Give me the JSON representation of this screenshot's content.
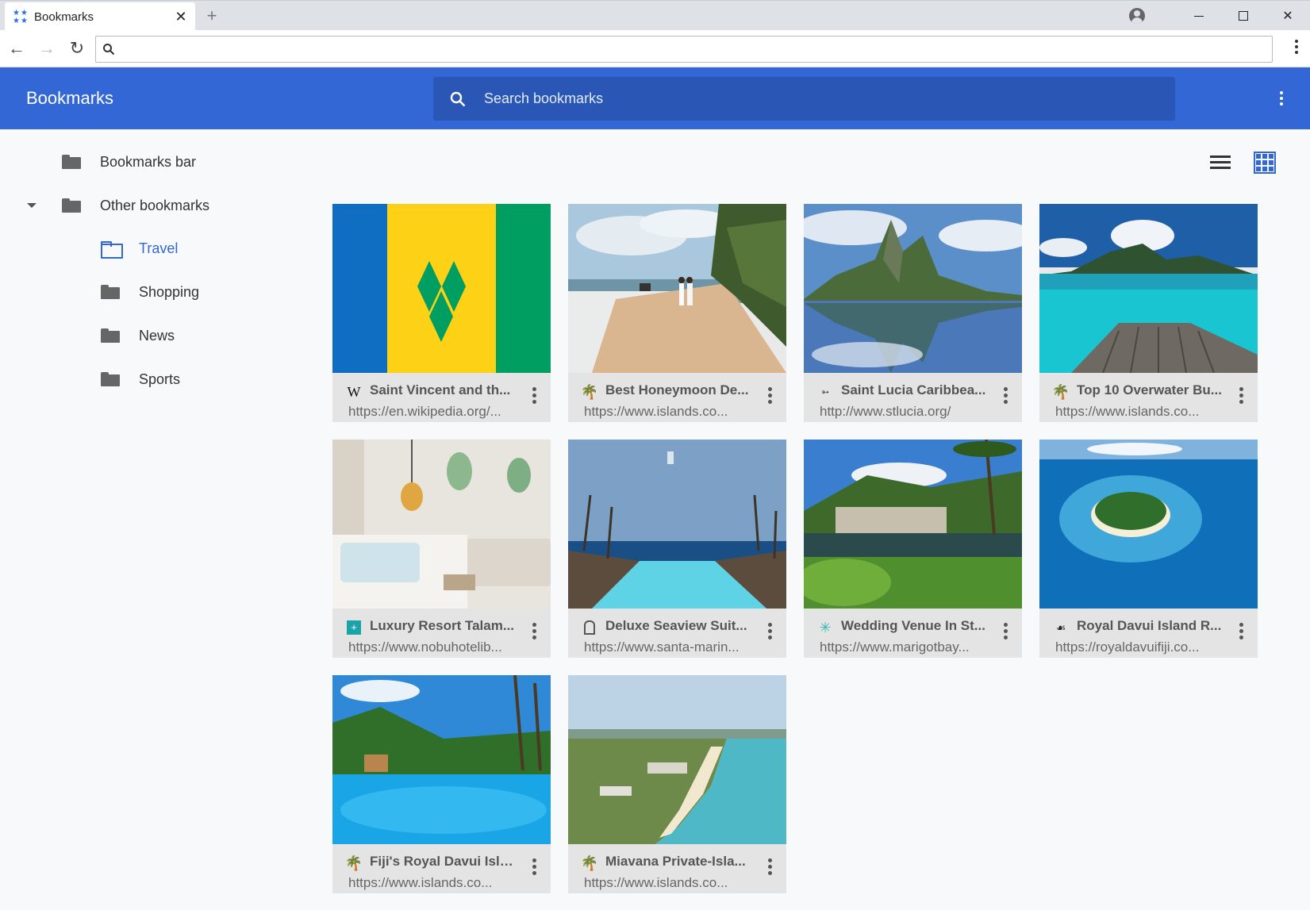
{
  "window": {
    "tab_title": "Bookmarks",
    "tab_close": "✕",
    "new_tab": "+"
  },
  "toolbar": {
    "back": "←",
    "forward": "→",
    "reload": "↻",
    "address_value": ""
  },
  "app": {
    "title": "Bookmarks",
    "search_placeholder": "Search bookmarks",
    "accent_color": "#3367d6"
  },
  "sidebar": {
    "items": [
      {
        "label": "Bookmarks bar",
        "icon": "folder-icon"
      },
      {
        "label": "Other bookmarks",
        "icon": "folder-icon",
        "expanded": true
      },
      {
        "label": "Travel",
        "icon": "folder-open-icon",
        "selected": true
      },
      {
        "label": "Shopping",
        "icon": "folder-icon"
      },
      {
        "label": "News",
        "icon": "folder-icon"
      },
      {
        "label": "Sports",
        "icon": "folder-icon"
      }
    ]
  },
  "view": {
    "mode": "grid"
  },
  "cards": [
    {
      "title": "Saint Vincent and th...",
      "url": "https://en.wikipedia.org/...",
      "favicon": "W"
    },
    {
      "title": "Best Honeymoon De...",
      "url": "https://www.islands.co...",
      "favicon": "palm"
    },
    {
      "title": "Saint Lucia Caribbea...",
      "url": "http://www.stlucia.org/",
      "favicon": "bird"
    },
    {
      "title": "Top 10 Overwater Bu...",
      "url": "https://www.islands.co...",
      "favicon": "palm"
    },
    {
      "title": "Luxury Resort Talam...",
      "url": "https://www.nobuhotelib...",
      "favicon": "nobu"
    },
    {
      "title": "Deluxe Seaview Suit...",
      "url": "https://www.santa-marin...",
      "favicon": "tower"
    },
    {
      "title": "Wedding Venue In St...",
      "url": "https://www.marigotbay...",
      "favicon": "star"
    },
    {
      "title": "Royal Davui Island R...",
      "url": "https://royaldavuifiji.co...",
      "favicon": "davui"
    },
    {
      "title": "Fiji's Royal Davui Isla...",
      "url": "https://www.islands.co...",
      "favicon": "palm"
    },
    {
      "title": "Miavana Private-Isla...",
      "url": "https://www.islands.co...",
      "favicon": "palm"
    }
  ]
}
